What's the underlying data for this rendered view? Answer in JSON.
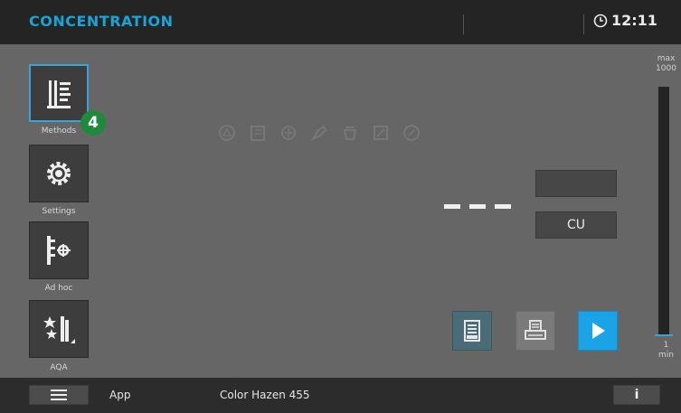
{
  "header": {
    "title": "CONCENTRATION",
    "time": "12:11"
  },
  "sidebar": {
    "items": [
      {
        "label": "Methods",
        "icon": "methods-icon",
        "selected": true
      },
      {
        "label": "Settings",
        "icon": "gear-icon",
        "selected": false
      },
      {
        "label": "Ad hoc",
        "icon": "adhoc-icon",
        "selected": false
      },
      {
        "label": "AQA",
        "icon": "aqa-icon",
        "selected": false
      }
    ],
    "badge": "4"
  },
  "status_icons": [
    "status-icon-1",
    "status-icon-2",
    "status-icon-3",
    "status-icon-4",
    "status-icon-5",
    "status-icon-6",
    "status-icon-7"
  ],
  "measurement": {
    "value": "",
    "unit": "CU"
  },
  "scale": {
    "max_label": "max",
    "max_value": "1000",
    "min_value": "1",
    "min_label": "min"
  },
  "footer": {
    "app_label": "App",
    "test_label": "Color Hazen 455",
    "info_label": "i"
  },
  "colors": {
    "accent": "#1aa3d6",
    "badge": "#1f8a3c",
    "play": "#1aa3e6"
  }
}
